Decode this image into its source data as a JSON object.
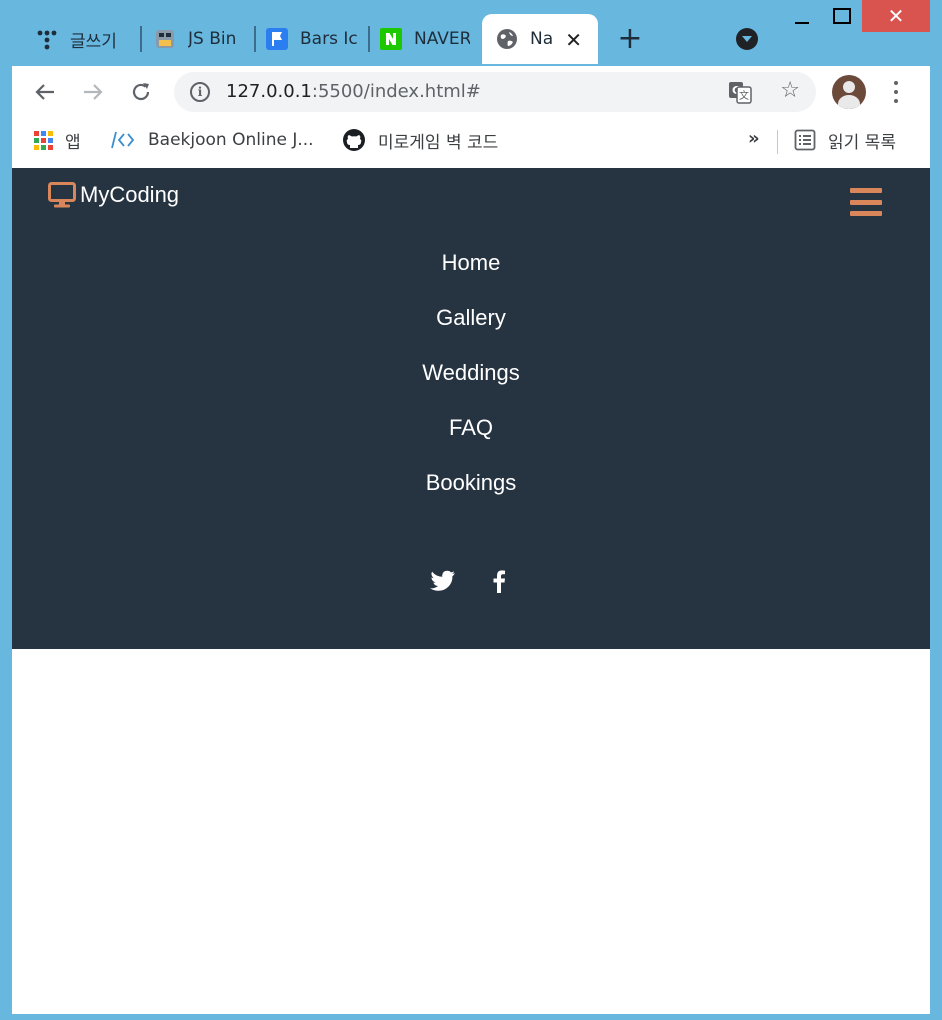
{
  "browser": {
    "tabs": [
      {
        "title": "글쓰기",
        "icon": "tistory-icon"
      },
      {
        "title": "JS Bin",
        "icon": "jsbin-icon"
      },
      {
        "title": "Bars Ic",
        "icon": "flag-icon"
      },
      {
        "title": "NAVER",
        "icon": "naver-icon"
      },
      {
        "title": "Na",
        "icon": "globe-icon",
        "active": true
      }
    ],
    "new_tab": "+",
    "close_tab": "✕",
    "window_close": "✕",
    "address": {
      "host": "127.0.0.1",
      "rest": ":5500/index.html#"
    },
    "bookmarks": [
      {
        "label": "앱",
        "icon": "apps-grid-icon"
      },
      {
        "label": "Baekjoon Online J...",
        "icon": "code-icon"
      },
      {
        "label": "미로게임 벽 코드",
        "icon": "github-icon"
      }
    ],
    "more_bookmarks": "»",
    "reading_list": "읽기 목록"
  },
  "site": {
    "brand": "MyCoding",
    "brand_icon": "desktop-icon",
    "menu": [
      "Home",
      "Gallery",
      "Weddings",
      "FAQ",
      "Bookings"
    ],
    "social": [
      "twitter-icon",
      "facebook-icon"
    ],
    "colors": {
      "navbar_bg": "#263341",
      "accent": "#d9875a",
      "text": "#ffffff"
    }
  }
}
